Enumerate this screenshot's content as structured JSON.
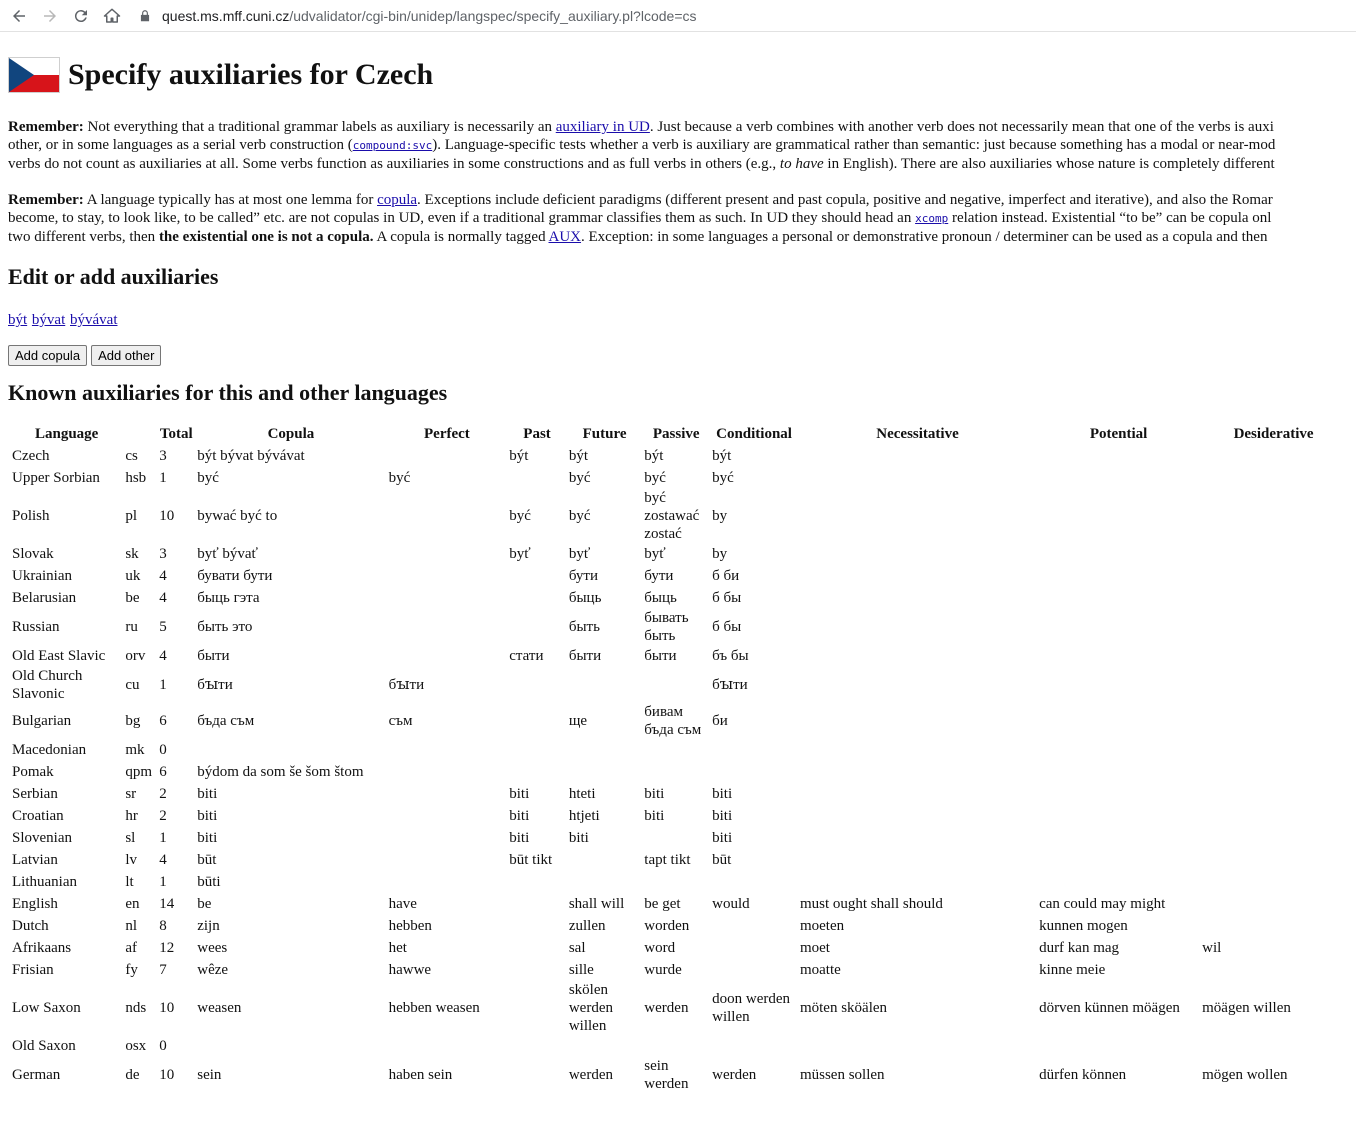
{
  "browser": {
    "url_host": "quest.ms.mff.cuni.cz",
    "url_path": "/udvalidator/cgi-bin/unidep/langspec/specify_auxiliary.pl?lcode=cs"
  },
  "page": {
    "title": "Specify auxiliaries for Czech",
    "flag_colors": [
      "#ffffff",
      "#d7141a",
      "#11457e"
    ],
    "remark1": {
      "label": "Remember:",
      "t1": " Not everything that a traditional grammar labels as auxiliary is necessarily an ",
      "link1": "auxiliary in UD",
      "t2": ". Just because a verb combines with another verb does not necessarily mean that one of the verbs is auxi",
      "line2a": "other, or in some languages as a serial verb construction (",
      "code1": "compound:svc",
      "line2b": "). Language-specific tests whether a verb is auxiliary are grammatical rather than semantic: just because something has a modal or near-mod",
      "line3a": "verbs do not count as auxiliaries at all. Some verbs function as auxiliaries in some constructions and as full verbs in others (e.g., ",
      "line3em": "to have",
      "line3b": " in English). There are also auxiliaries whose nature is completely different"
    },
    "remark2": {
      "label": "Remember:",
      "t1": " A language typically has at most one lemma for ",
      "link1": "copula",
      "t2": ". Exceptions include deficient paradigms (different present and past copula, positive and negative, imperfect and iterative), and also the Romar",
      "line2a": "become, to stay, to look like, to be called” etc. are not copulas in UD, even if a traditional grammar classifies them as such. In UD they should head an ",
      "code1": "xcomp",
      "line2b": " relation instead. Existential “to be” can be copula onl",
      "line3a": "two different verbs, then ",
      "line3bold": "the existential one is not a copula.",
      "line3b": " A copula is normally tagged ",
      "link2": "AUX",
      "line3c": ". Exception: in some languages a personal or demonstrative pronoun / determiner can be used as a copula and then"
    },
    "edit_heading": "Edit or add auxiliaries",
    "aux_links": [
      "být",
      "bývat",
      "bývávat"
    ],
    "buttons": {
      "add_copula": "Add copula",
      "add_other": "Add other"
    },
    "known_heading": "Known auxiliaries for this and other languages"
  },
  "table": {
    "headers": [
      "Language",
      "",
      "Total",
      "Copula",
      "Perfect",
      "Past",
      "Future",
      "Passive",
      "Conditional",
      "Necessitative",
      "Potential",
      "Desiderative"
    ],
    "rows": [
      [
        "Czech",
        "cs",
        "3",
        "být bývat bývávat",
        "",
        "být",
        "být",
        "být",
        "být",
        "",
        "",
        ""
      ],
      [
        "Upper Sorbian",
        "hsb",
        "1",
        "być",
        "być",
        "",
        "być",
        "być",
        "być",
        "",
        "",
        ""
      ],
      [
        "Polish",
        "pl",
        "10",
        "bywać być to",
        "",
        "być",
        "być",
        "być\nzostawać\nzostać",
        "by",
        "",
        "",
        ""
      ],
      [
        "Slovak",
        "sk",
        "3",
        "byť bývať",
        "",
        "byť",
        "byť",
        "byť",
        "by",
        "",
        "",
        ""
      ],
      [
        "Ukrainian",
        "uk",
        "4",
        "бувати бути",
        "",
        "",
        "бути",
        "бути",
        "б би",
        "",
        "",
        ""
      ],
      [
        "Belarusian",
        "be",
        "4",
        "быць гэта",
        "",
        "",
        "быць",
        "быць",
        "б бы",
        "",
        "",
        ""
      ],
      [
        "Russian",
        "ru",
        "5",
        "быть это",
        "",
        "",
        "быть",
        "бывать\nбыть",
        "б бы",
        "",
        "",
        ""
      ],
      [
        "Old East Slavic",
        "orv",
        "4",
        "быти",
        "",
        "стати",
        "быти",
        "быти",
        "бъ бы",
        "",
        "",
        ""
      ],
      [
        "Old Church\nSlavonic",
        "cu",
        "1",
        "бꙑти",
        "бꙑти",
        "",
        "",
        "",
        "бꙑти",
        "",
        "",
        ""
      ],
      [
        "Bulgarian",
        "bg",
        "6",
        "бъда съм",
        "съм",
        "",
        "ще",
        "бивам\nбъда съм",
        "би",
        "",
        "",
        ""
      ],
      [
        "Macedonian",
        "mk",
        "0",
        "",
        "",
        "",
        "",
        "",
        "",
        "",
        "",
        ""
      ],
      [
        "Pomak",
        "qpm",
        "6",
        "býdom da som še šom štom",
        "",
        "",
        "",
        "",
        "",
        "",
        "",
        ""
      ],
      [
        "Serbian",
        "sr",
        "2",
        "biti",
        "",
        "biti",
        "hteti",
        "biti",
        "biti",
        "",
        "",
        ""
      ],
      [
        "Croatian",
        "hr",
        "2",
        "biti",
        "",
        "biti",
        "htjeti",
        "biti",
        "biti",
        "",
        "",
        ""
      ],
      [
        "Slovenian",
        "sl",
        "1",
        "biti",
        "",
        "biti",
        "biti",
        "",
        "biti",
        "",
        "",
        ""
      ],
      [
        "Latvian",
        "lv",
        "4",
        "būt",
        "",
        "būt tikt",
        "",
        "tapt tikt",
        "būt",
        "",
        "",
        ""
      ],
      [
        "Lithuanian",
        "lt",
        "1",
        "būti",
        "",
        "",
        "",
        "",
        "",
        "",
        "",
        ""
      ],
      [
        "English",
        "en",
        "14",
        "be",
        "have",
        "",
        "shall will",
        "be get",
        "would",
        "must ought shall should",
        "can could may might",
        ""
      ],
      [
        "Dutch",
        "nl",
        "8",
        "zijn",
        "hebben",
        "",
        "zullen",
        "worden",
        "",
        "moeten",
        "kunnen mogen",
        ""
      ],
      [
        "Afrikaans",
        "af",
        "12",
        "wees",
        "het",
        "",
        "sal",
        "word",
        "",
        "moet",
        "durf kan mag",
        "wil"
      ],
      [
        "Frisian",
        "fy",
        "7",
        "wêze",
        "hawwe",
        "",
        "sille",
        "wurde",
        "",
        "moatte",
        "kinne meie",
        ""
      ],
      [
        "Low Saxon",
        "nds",
        "10",
        "weasen",
        "hebben weasen",
        "",
        "skölen\nwerden\nwillen",
        "werden",
        "doon werden\nwillen",
        "möten sköälen",
        "dörven künnen möägen",
        "möägen willen"
      ],
      [
        "Old Saxon",
        "osx",
        "0",
        "",
        "",
        "",
        "",
        "",
        "",
        "",
        "",
        ""
      ],
      [
        "German",
        "de",
        "10",
        "sein",
        "haben sein",
        "",
        "werden",
        "sein\nwerden",
        "werden",
        "müssen sollen",
        "dürfen können",
        "mögen wollen"
      ]
    ]
  }
}
